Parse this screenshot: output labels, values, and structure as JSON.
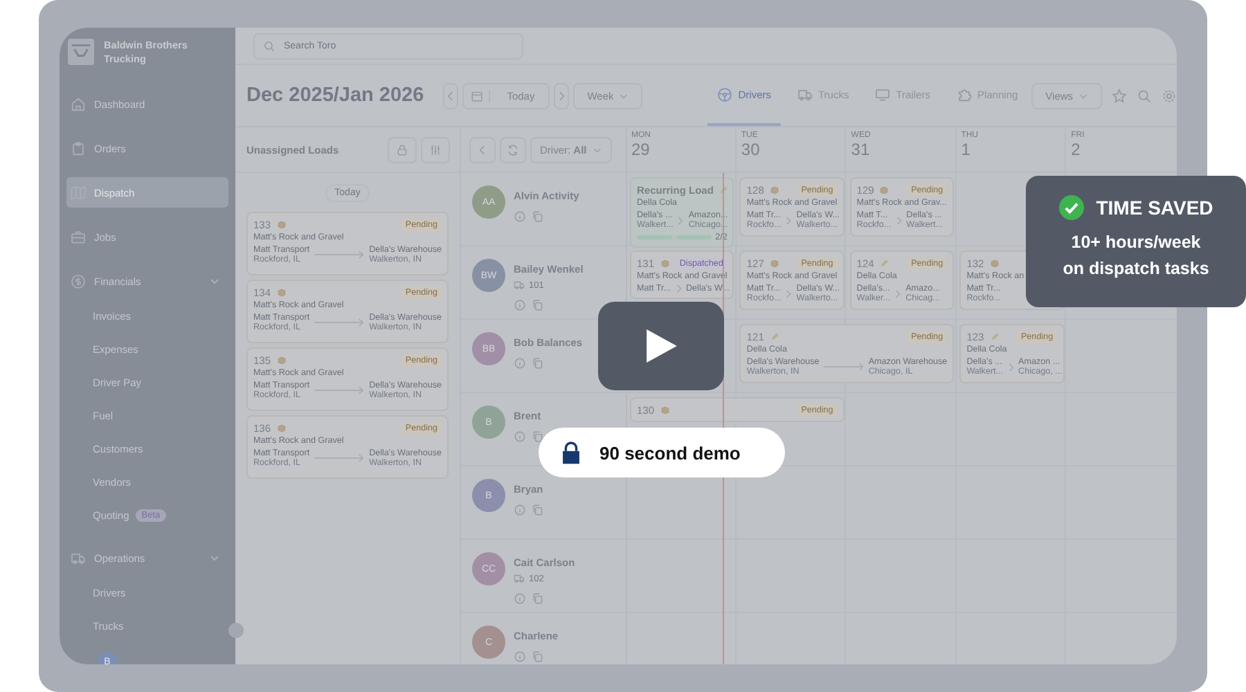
{
  "sidebar": {
    "company": "Baldwin Brothers Trucking",
    "items": [
      {
        "label": "Dashboard",
        "selected": false
      },
      {
        "label": "Orders",
        "selected": false
      },
      {
        "label": "Dispatch",
        "selected": true
      },
      {
        "label": "Jobs",
        "selected": false
      },
      {
        "label": "Financials",
        "selected": false,
        "expanded": true,
        "children": [
          {
            "label": "Invoices"
          },
          {
            "label": "Expenses"
          },
          {
            "label": "Driver Pay"
          },
          {
            "label": "Fuel"
          },
          {
            "label": "Customers"
          },
          {
            "label": "Vendors"
          },
          {
            "label": "Quoting",
            "badge": "Beta"
          }
        ]
      },
      {
        "label": "Operations",
        "selected": false,
        "expanded": true,
        "children": [
          {
            "label": "Drivers"
          },
          {
            "label": "Trucks"
          }
        ]
      }
    ],
    "user_initial": "B"
  },
  "search": {
    "placeholder": "Search Toro"
  },
  "toolbar": {
    "title": "Dec 2025/Jan 2026",
    "today": "Today",
    "range": "Week",
    "views": "Views",
    "tabs": [
      {
        "label": "Drivers",
        "selected": true
      },
      {
        "label": "Trucks",
        "selected": false
      },
      {
        "label": "Trailers",
        "selected": false
      },
      {
        "label": "Planning",
        "selected": false
      }
    ]
  },
  "unassigned": {
    "title": "Unassigned Loads",
    "group": "Today",
    "loads": [
      {
        "number": "133",
        "kind": "package",
        "status": {
          "label": "Pending",
          "kind": "pending"
        },
        "customer": "Matt's Rock and Gravel",
        "origin": "Matt Transport",
        "destination": "Della's Warehouse",
        "origin_city": "Rockford, IL",
        "destination_city": "Walkerton, IN"
      },
      {
        "number": "134",
        "kind": "package",
        "status": {
          "label": "Pending",
          "kind": "pending"
        },
        "customer": "Matt's Rock and Gravel",
        "origin": "Matt Transport",
        "destination": "Della's Warehouse",
        "origin_city": "Rockford, IL",
        "destination_city": "Walkerton, IN"
      },
      {
        "number": "135",
        "kind": "package",
        "status": {
          "label": "Pending",
          "kind": "pending"
        },
        "customer": "Matt's Rock and Gravel",
        "origin": "Matt Transport",
        "destination": "Della's Warehouse",
        "origin_city": "Rockford, IL",
        "destination_city": "Walkerton, IN"
      },
      {
        "number": "136",
        "kind": "package",
        "status": {
          "label": "Pending",
          "kind": "pending"
        },
        "customer": "Matt's Rock and Gravel",
        "origin": "Matt Transport",
        "destination": "Della's Warehouse",
        "origin_city": "Rockford, IL",
        "destination_city": "Walkerton, IN"
      }
    ]
  },
  "calendar": {
    "driver_filter": "Driver: **All**",
    "days": [
      {
        "weekday": "MON",
        "date": "29"
      },
      {
        "weekday": "TUE",
        "date": "30"
      },
      {
        "weekday": "WED",
        "date": "31"
      },
      {
        "weekday": "THU",
        "date": "1"
      },
      {
        "weekday": "FRI",
        "date": "2"
      }
    ],
    "drivers": [
      {
        "initials": "AA",
        "name": "Alvin Activity",
        "color": "#8f9c88",
        "slots": [
          {
            "kind": "recurring",
            "load": {
              "number": "Recurring Load",
              "kind": "note",
              "customer": "Della Cola",
              "origin": "Della's ...",
              "destination": "Amazon...",
              "origin_city": "Walkert...",
              "destination_city": "Chicago...",
              "progress": {
                "level": 1,
                "reading": "2/2"
              }
            }
          },
          {
            "kind": "load",
            "load": {
              "number": "128",
              "kind": "package",
              "status": {
                "label": "Pending",
                "kind": "pending"
              },
              "customer": "Matt's Rock and Gravel",
              "origin": "Matt Tr...",
              "destination": "Della's W...",
              "origin_city": "Rockfo...",
              "destination_city": "Walkerto..."
            }
          },
          {
            "kind": "load",
            "load": {
              "number": "129",
              "kind": "package",
              "status": {
                "label": "Pending",
                "kind": "pending"
              },
              "customer": "Matt's Rock and Grav...",
              "origin": "Matt T...",
              "destination": "Della's ...",
              "origin_city": "Rockfo...",
              "destination_city": "Walkert..."
            }
          },
          {
            "kind": "empty"
          },
          {
            "kind": "empty"
          }
        ]
      },
      {
        "initials": "BW",
        "name": "Bailey Wenkel",
        "truck": "101",
        "color": "#8891a3",
        "slots": [
          {
            "kind": "load",
            "load": {
              "number": "131",
              "kind": "package",
              "status": {
                "label": "Dispatched",
                "kind": "dispatched"
              },
              "customer": "Matt's Rock and Gravel",
              "origin": "Matt Tr...",
              "destination": "Della's W..."
            }
          },
          {
            "kind": "load",
            "load": {
              "number": "127",
              "kind": "package",
              "status": {
                "label": "Pending",
                "kind": "pending"
              },
              "customer": "Matt's Rock and Gravel",
              "origin": "Matt Tr...",
              "destination": "Della's W...",
              "origin_city": "Rockfo...",
              "destination_city": "Walkerto..."
            }
          },
          {
            "kind": "load",
            "load": {
              "number": "124",
              "kind": "note",
              "status": {
                "label": "Pending",
                "kind": "pending"
              },
              "customer": "Della Cola",
              "origin": "Della's...",
              "destination": "Amazo...",
              "origin_city": "Walker...",
              "destination_city": "Chicag..."
            }
          },
          {
            "kind": "load",
            "load": {
              "number": "132",
              "kind": "package",
              "customer": "Matt's Rock an",
              "origin": "Matt Tr...",
              "origin_city": "Rockfo..."
            }
          },
          {
            "kind": "empty"
          }
        ]
      },
      {
        "initials": "BB",
        "name": "Bob Balances",
        "color": "#a08fa6",
        "slots": [
          {
            "kind": "empty"
          },
          {
            "kind": "load",
            "load": {
              "number": "121",
              "kind": "note",
              "status": {
                "label": "Pending",
                "kind": "pending"
              },
              "customer": "Della Cola",
              "origin": "Della's Warehouse",
              "destination": "Amazon Warehouse",
              "origin_city": "Walkerton, IN",
              "destination_city": "Chicago, IL"
            }
          },
          {
            "kind": "continued"
          },
          {
            "kind": "load",
            "load": {
              "number": "123",
              "kind": "note",
              "status": {
                "label": "Pending",
                "kind": "pending"
              },
              "customer": "Della Cola",
              "origin": "Della's ...",
              "destination": "Amazon ...",
              "origin_city": "Walkert...",
              "destination_city": "Chicago, ..."
            }
          },
          {
            "kind": "empty"
          }
        ]
      },
      {
        "initials": "B",
        "name": "Brent",
        "color": "#8fa496",
        "slots": [
          {
            "kind": "load",
            "load": {
              "number": "130",
              "kind": "package",
              "status": {
                "label": "Pending",
                "kind": "pending"
              }
            }
          },
          {
            "kind": "continued"
          },
          {
            "kind": "empty"
          },
          {
            "kind": "empty"
          },
          {
            "kind": "empty"
          }
        ]
      },
      {
        "initials": "B",
        "name": "Bryan",
        "color": "#8c8fab",
        "slots": [
          {
            "kind": "empty"
          },
          {
            "kind": "empty"
          },
          {
            "kind": "empty"
          },
          {
            "kind": "empty"
          },
          {
            "kind": "empty"
          }
        ]
      },
      {
        "initials": "CC",
        "name": "Cait Carlson",
        "truck": "102",
        "color": "#a28fa5",
        "slots": [
          {
            "kind": "empty"
          },
          {
            "kind": "empty"
          },
          {
            "kind": "empty"
          },
          {
            "kind": "empty"
          },
          {
            "kind": "empty"
          }
        ]
      },
      {
        "initials": "C",
        "name": "Charlene",
        "color": "#a3908f",
        "slots": [
          {
            "kind": "empty"
          },
          {
            "kind": "empty"
          },
          {
            "kind": "empty"
          },
          {
            "kind": "empty"
          },
          {
            "kind": "empty"
          }
        ]
      }
    ]
  },
  "video": {
    "demo_label": "90 second demo"
  },
  "callout": {
    "title": "TIME SAVED",
    "lines": [
      "10+ hours/week",
      "on dispatch tasks"
    ]
  }
}
